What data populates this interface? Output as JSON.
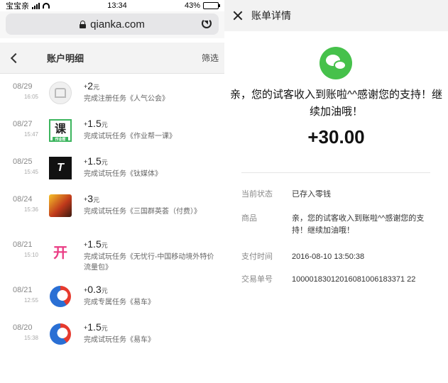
{
  "left": {
    "status": {
      "carrier": "宝宝亲",
      "time": "13:34",
      "battery": "43%",
      "battery_level": 0.43
    },
    "url": "qianka.com",
    "nav": {
      "title": "账户明细",
      "filter": "筛选"
    },
    "items": [
      {
        "date": "08/29",
        "time": "16:05",
        "icon": "gray-building-icon",
        "amount": "2",
        "unit": "元",
        "desc": "完成注册任务《人气公会》"
      },
      {
        "date": "08/27",
        "time": "15:47",
        "icon": "course-app-icon",
        "icon_text": "课",
        "icon_sub": "作业帮",
        "amount": "1.5",
        "unit": "元",
        "desc": "完成试玩任务《作业帮一课》"
      },
      {
        "date": "08/25",
        "time": "15:45",
        "icon": "tmtpost-icon",
        "icon_text": "T",
        "amount": "1.5",
        "unit": "元",
        "desc": "完成试玩任务《钛媒体》"
      },
      {
        "date": "08/24",
        "time": "15:36",
        "icon": "game-icon",
        "amount": "3",
        "unit": "元",
        "desc": "完成试玩任务《三国群英荟（付费）》"
      },
      {
        "date": "08/21",
        "time": "15:10",
        "icon": "wuyouxing-icon",
        "icon_text": "开",
        "amount": "1.5",
        "unit": "元",
        "desc": "完成试玩任务《无忧行-中国移动境外特价流量包》"
      },
      {
        "date": "08/21",
        "time": "12:55",
        "icon": "yiche-icon",
        "amount": "0.3",
        "unit": "元",
        "desc": "完成专属任务《易车》"
      },
      {
        "date": "08/20",
        "time": "15:38",
        "icon": "yiche-icon",
        "amount": "1.5",
        "unit": "元",
        "desc": "完成试玩任务《易车》"
      }
    ]
  },
  "right": {
    "header_title": "账单详情",
    "message": "亲，您的试客收入到账啦^^感谢您的支持！继续加油哦！",
    "amount": "+30.00",
    "rows": [
      {
        "key": "当前状态",
        "value": "已存入零钱"
      },
      {
        "key": "商品",
        "value": "亲，您的试客收入到账啦^^感谢您的支持！继续加油哦！"
      },
      {
        "key": "支付时间",
        "value": "2016-08-10 13:50:38"
      },
      {
        "key": "交易单号",
        "value": "10000183012016081006183371 22"
      }
    ]
  }
}
